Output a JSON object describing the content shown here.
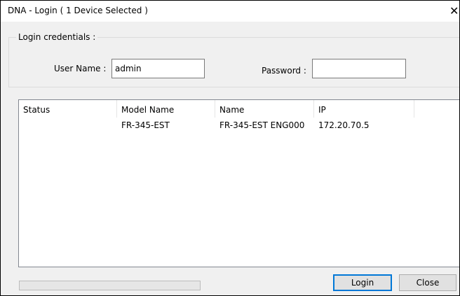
{
  "window": {
    "title": "DNA - Login ( 1 Device Selected )",
    "close_glyph": "✕"
  },
  "credentials": {
    "group_label": "Login credentials :",
    "username_label": "User Name :",
    "username_value": "admin",
    "password_label": "Password :",
    "password_value": ""
  },
  "device_list": {
    "columns": [
      "Status",
      "Model Name",
      "Name",
      "IP"
    ],
    "rows": [
      {
        "status": "",
        "model_name": "FR-345-EST",
        "name": "FR-345-EST ENG000",
        "ip": "172.20.70.5"
      }
    ]
  },
  "progress": {
    "fraction": 0
  },
  "buttons": {
    "login_label": "Login",
    "close_label": "Close"
  },
  "colors": {
    "default_button_border": "#0078d7",
    "progress_fill": "#06b025"
  }
}
